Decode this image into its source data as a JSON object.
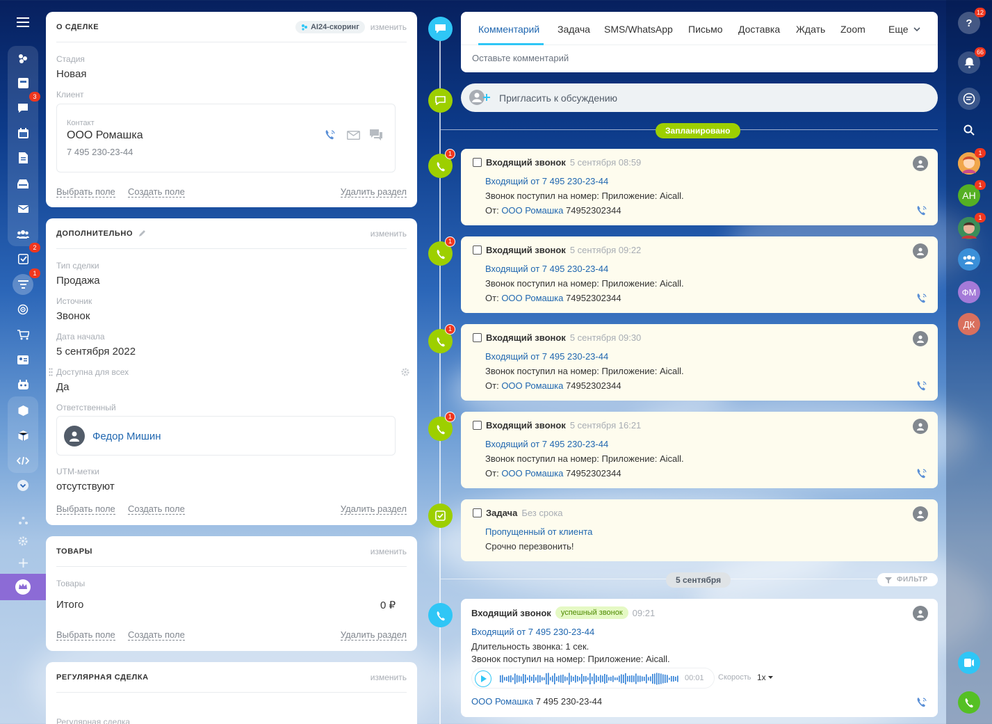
{
  "left_nav": {
    "badges": {
      "chat": "3",
      "tasks": "2",
      "crm": "1"
    }
  },
  "deal_card": {
    "title": "О СДЕЛКЕ",
    "ai_badge": "AI24-скоринг",
    "edit": "изменить",
    "stage_label": "Стадия",
    "stage_value": "Новая",
    "client_label": "Клиент",
    "contact_type": "Контакт",
    "contact_name": "ООО Ромашка",
    "contact_phone": "7 495 230-23-44",
    "footer": {
      "select": "Выбрать поле",
      "create": "Создать поле",
      "delete": "Удалить раздел"
    }
  },
  "extra_card": {
    "title": "ДОПОЛНИТЕЛЬНО",
    "edit": "изменить",
    "fields": [
      {
        "label": "Тип сделки",
        "value": "Продажа"
      },
      {
        "label": "Источник",
        "value": "Звонок"
      },
      {
        "label": "Дата начала",
        "value": "5 сентября 2022"
      },
      {
        "label": "Доступна для всех",
        "value": "Да"
      }
    ],
    "responsible_label": "Ответственный",
    "responsible_name": "Федор Мишин",
    "utm_label": "UTM-метки",
    "utm_value": "отсутствуют",
    "footer": {
      "select": "Выбрать поле",
      "create": "Создать поле",
      "delete": "Удалить раздел"
    }
  },
  "goods_card": {
    "title": "ТОВАРЫ",
    "edit": "изменить",
    "goods_label": "Товары",
    "total_label": "Итого",
    "total_value": "0 ₽",
    "footer": {
      "select": "Выбрать поле",
      "create": "Создать поле",
      "delete": "Удалить раздел"
    }
  },
  "regular_card": {
    "title": "РЕГУЛЯРНАЯ СДЕЛКА",
    "edit": "изменить",
    "field_label": "Регулярная сделка"
  },
  "composer": {
    "tabs": [
      "Комментарий",
      "Задача",
      "SMS/WhatsApp",
      "Письмо",
      "Доставка",
      "Ждать",
      "Zoom"
    ],
    "more": "Еще",
    "placeholder": "Оставьте комментарий",
    "invite": "Пригласить к обсуждению"
  },
  "planned_label": "Запланировано",
  "calls": [
    {
      "title": "Входящий звонок",
      "time": "5 сентября 08:59",
      "link": "Входящий от 7 495 230-23-44",
      "text": "Звонок поступил на номер: Приложение: Aicall.",
      "from_label": "От:",
      "from_name": "ООО Ромашка",
      "from_phone": "74952302344",
      "badge": "1"
    },
    {
      "title": "Входящий звонок",
      "time": "5 сентября 09:22",
      "link": "Входящий от 7 495 230-23-44",
      "text": "Звонок поступил на номер: Приложение: Aicall.",
      "from_label": "От:",
      "from_name": "ООО Ромашка",
      "from_phone": "74952302344",
      "badge": "1"
    },
    {
      "title": "Входящий звонок",
      "time": "5 сентября 09:30",
      "link": "Входящий от 7 495 230-23-44",
      "text": "Звонок поступил на номер: Приложение: Aicall.",
      "from_label": "От:",
      "from_name": "ООО Ромашка",
      "from_phone": "74952302344",
      "badge": "1"
    },
    {
      "title": "Входящий звонок",
      "time": "5 сентября 16:21",
      "link": "Входящий от 7 495 230-23-44",
      "text": "Звонок поступил на номер: Приложение: Aicall.",
      "from_label": "От:",
      "from_name": "ООО Ромашка",
      "from_phone": "74952302344",
      "badge": "1"
    }
  ],
  "task": {
    "title": "Задача",
    "deadline": "Без срока",
    "link": "Пропущенный от клиента",
    "text": "Срочно перезвонить!"
  },
  "date_label": "5 сентября",
  "filter_label": "ФИЛЬТР",
  "history_call": {
    "title": "Входящий звонок",
    "status": "успешный звонок",
    "time": "09:21",
    "link": "Входящий от 7 495 230-23-44",
    "duration": "Длительность звонка: 1 сек.",
    "text": "Звонок поступил на номер: Приложение: Aicall.",
    "player_time": "00:01",
    "speed_label": "Скорость",
    "speed_value": "1x",
    "contact_name": "ООО Ромашка",
    "contact_phone": "7 495 230-23-44"
  },
  "right_nav": {
    "help_badge": "12",
    "notif_badge": "66",
    "user1_badge": "1",
    "user2_initials": "АН",
    "user2_badge": "1",
    "user3_badge": "1",
    "user4_initials": "ФМ",
    "user5_initials": "ДК"
  },
  "colors": {
    "accent": "#2fc6f6",
    "green": "#9dcf00",
    "link": "#2067b0",
    "badge": "#f0371e"
  }
}
